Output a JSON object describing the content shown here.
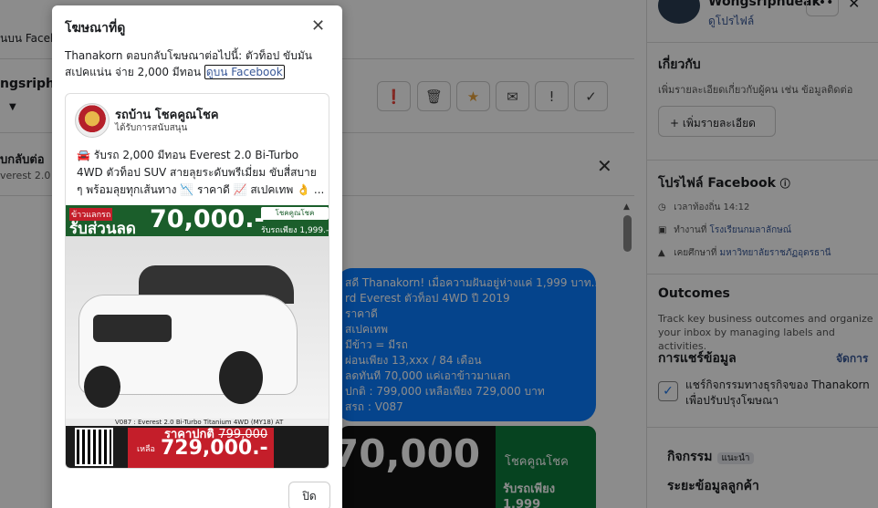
{
  "background": {
    "top_link": "นบน Faceb",
    "username": "ngsriphue",
    "thread_title": "บกลับต่อ",
    "thread_sub": "verest 2.0 B",
    "toolbar_icons": [
      "alert-circle-icon",
      "trash-icon",
      "star-icon",
      "envelope-icon",
      "exclamation-icon",
      "check-icon"
    ],
    "bubble_lines": [
      "สดี Thanakorn! เมื่อความฝันอยู่ห่างแค่ 1,999 บาท...",
      "rd Everest ตัวท็อป 4WD ปี 2019",
      "ราคาดี",
      "สเปคเทพ",
      "มีข้าว = มีรถ",
      "ผ่อนเพียง 13,xxx / 84 เดือน",
      "ลดทันที 70,000 แค่เอาข้าวมาแลก",
      "ปกติ : 799,000 เหลือเพียง 729,000 บาท",
      "สรถ : V087"
    ],
    "ad2_big": "70,000",
    "ad2_green_top": "โชคคูณโชค",
    "ad2_green_bottom": "รับรถเพียง 1,999"
  },
  "right_panel": {
    "name": "Wongsriphueak",
    "profile_link": "ดูโปรไฟล์",
    "more": "•••",
    "close": "✕",
    "about_heading": "เกี่ยวกับ",
    "about_sub": "เพิ่มรายละเอียดเกี่ยวกับผู้คน เช่น ข้อมูลติดต่อ",
    "add_details": "+ เพิ่มรายละเอียด",
    "fb_profile_heading": "โปรไฟล์ Facebook",
    "rows": [
      {
        "icon": "clock-icon",
        "label": "เวลาท้องถิ่น 14:12",
        "link": ""
      },
      {
        "icon": "briefcase-icon",
        "label": "ทำงานที่ ",
        "link": "โรงเรียนกมลาลักษณ์"
      },
      {
        "icon": "graduation-cap-icon",
        "label": "เคยศึกษาที่ ",
        "link": "มหาวิทยาลัยราชภัฏอุดรธานี"
      }
    ],
    "outcomes_heading": "Outcomes",
    "outcomes_sub": "Track key business outcomes and organize your inbox by managing labels and activities.",
    "share_heading": "การแชร์ข้อมูล",
    "manage": "จัดการ",
    "share_label": "แชร์กิจกรรมทางธุรกิจของ Thanakorn เพื่อปรับปรุงโฆษณา",
    "activity_heading": "กิจกรรม",
    "activity_tag": "แนะนำ",
    "customer_heading": "ระยะข้อมูลลูกค้า"
  },
  "modal": {
    "title": "โฆษณาที่ดู",
    "close": "✕",
    "desc_text": "Thanakorn ตอบกลับโฆษณาต่อไปนี้: ตัวท็อป ขับมัน สเปคแน่น จ่าย 2,000 มีทอน ",
    "desc_link": "ดูบน Facebook",
    "page_name": "รถบ้าน โชคคูณโชค",
    "sponsored": "ได้รับการสนับสนุน",
    "ad_text": "🚘 รับรถ 2,000 มีทอน Everest 2.0 Bi-Turbo 4WD ตัวท็อป SUV สายลุยระดับพรีเมี่ยม ขับสี่สบาย ๆ พร้อมลุยทุกเส้นทาง 📉 ราคาดี 📈 สเปคเทพ 👌 ...",
    "ad_image": {
      "tag": "ข้าวแลกรถ",
      "promo": "รับส่วนลด",
      "discount": "70,000.-",
      "brand": "โชคคูณโชค",
      "down": "รับรถเพียง 1,999.-",
      "model": "V087 : Everest 2.0 Bi-Turbo Titanium 4WD (MY18) AT",
      "normal_price": "ราคาปกติ",
      "normal_value": "799,000",
      "remain": "เหลือ",
      "final_price": "729,000.-"
    },
    "close_button": "ปิด"
  }
}
